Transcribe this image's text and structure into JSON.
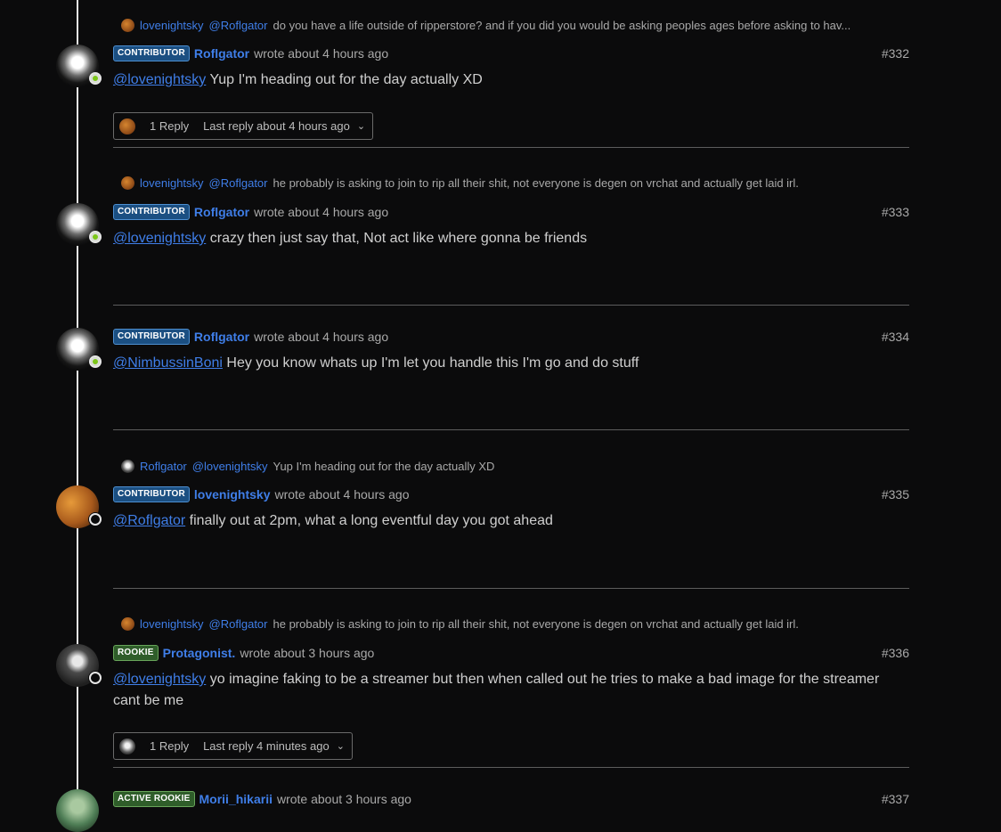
{
  "posts": [
    {
      "number": "#332",
      "parent": {
        "user": "lovenightsky",
        "mention": "@Roflgator",
        "text": "do you have a life outside of ripperstore? and if you did you would be asking peoples ages before asking to hav..."
      },
      "badge": "CONTRIBUTOR",
      "author": "Roflgator",
      "meta": "wrote about 4 hours ago",
      "mention": "@lovenightsky",
      "body": "Yup I'm heading out for the day actually XD",
      "replies": {
        "count": "1 Reply",
        "last": "Last reply about 4 hours ago"
      }
    },
    {
      "number": "#333",
      "parent": {
        "user": "lovenightsky",
        "mention": "@Roflgator",
        "text": "he probably is asking to join to rip all their shit, not everyone is degen on vrchat and actually get laid irl."
      },
      "badge": "CONTRIBUTOR",
      "author": "Roflgator",
      "meta": "wrote about 4 hours ago",
      "mention": "@lovenightsky",
      "body": "crazy then just say that, Not act like where gonna be friends"
    },
    {
      "number": "#334",
      "badge": "CONTRIBUTOR",
      "author": "Roflgator",
      "meta": "wrote about 4 hours ago",
      "mention": "@NimbussinBoni",
      "body": "Hey you know whats up I'm let you handle this I'm go and do stuff"
    },
    {
      "number": "#335",
      "parent": {
        "user": "Roflgator",
        "mention": "@lovenightsky",
        "text": "Yup I'm heading out for the day actually XD"
      },
      "badge": "CONTRIBUTOR",
      "author": "lovenightsky",
      "meta": "wrote about 4 hours ago",
      "mention": "@Roflgator",
      "body": "finally out at 2pm, what a long eventful day you got ahead"
    },
    {
      "number": "#336",
      "parent": {
        "user": "lovenightsky",
        "mention": "@Roflgator",
        "text": "he probably is asking to join to rip all their shit, not everyone is degen on vrchat and actually get laid irl."
      },
      "badge": "ROOKIE",
      "author": "Protagonist.",
      "meta": "wrote about 3 hours ago",
      "mention": "@lovenightsky",
      "body": "yo imagine faking to be a streamer but then when called out he tries to make a bad image for the streamer cant be me",
      "replies": {
        "count": "1 Reply",
        "last": "Last reply 4 minutes ago"
      }
    },
    {
      "number": "#337",
      "badge": "ACTIVE ROOKIE",
      "author": "Morii_hikarii",
      "meta": "wrote about 3 hours ago"
    }
  ],
  "icons": {
    "chevron": "chevron-down-icon",
    "online": "online-status-icon",
    "offline": "offline-status-icon"
  },
  "colors": {
    "link": "#3f7ee8",
    "online": "#7bc618",
    "contributor_badge": "#1b4f82",
    "rookie_badge": "#2f5d2a",
    "background": "#0b0b0c"
  }
}
